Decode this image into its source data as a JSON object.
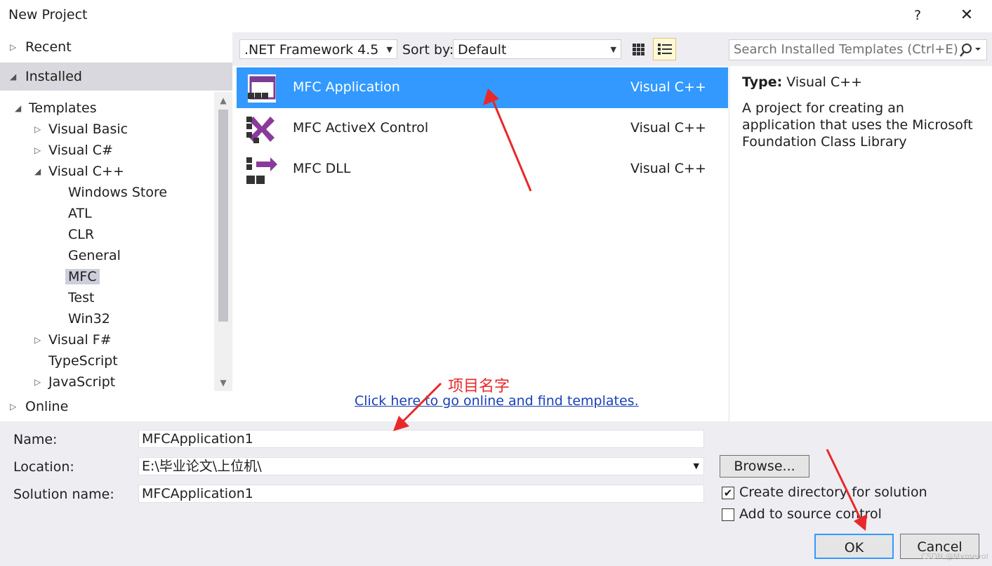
{
  "window": {
    "title": "New Project",
    "help_label": "?",
    "close_label": "✕"
  },
  "left_nav": {
    "recent": "Recent",
    "installed": "Installed",
    "online": "Online",
    "tree": [
      {
        "label": "Templates",
        "level": 0,
        "expanded": true
      },
      {
        "label": "Visual Basic",
        "level": 1,
        "expanded": false
      },
      {
        "label": "Visual C#",
        "level": 1,
        "expanded": false
      },
      {
        "label": "Visual C++",
        "level": 1,
        "expanded": true
      },
      {
        "label": "Windows Store",
        "level": 2
      },
      {
        "label": "ATL",
        "level": 2
      },
      {
        "label": "CLR",
        "level": 2
      },
      {
        "label": "General",
        "level": 2
      },
      {
        "label": "MFC",
        "level": 2,
        "selected": true
      },
      {
        "label": "Test",
        "level": 2
      },
      {
        "label": "Win32",
        "level": 2
      },
      {
        "label": "Visual F#",
        "level": 1,
        "expanded": false
      },
      {
        "label": "TypeScript",
        "level": 1
      },
      {
        "label": "JavaScript",
        "level": 1,
        "expanded": false
      }
    ]
  },
  "toolbar": {
    "framework": ".NET Framework 4.5",
    "sort_label": "Sort by:",
    "sort_value": "Default",
    "search_placeholder": "Search Installed Templates (Ctrl+E)"
  },
  "templates": [
    {
      "name": "MFC Application",
      "language": "Visual C++",
      "selected": true
    },
    {
      "name": "MFC ActiveX Control",
      "language": "Visual C++"
    },
    {
      "name": "MFC DLL",
      "language": "Visual C++"
    }
  ],
  "online_link": "Click here to go online and find templates.",
  "details": {
    "type_label": "Type:",
    "type_value": "Visual C++",
    "description": "A project for creating an application that uses the Microsoft Foundation Class Library"
  },
  "form": {
    "name_label": "Name:",
    "name_value": "MFCApplication1",
    "location_label": "Location:",
    "location_value": "E:\\毕业论文\\上位机\\",
    "solution_label": "Solution name:",
    "solution_value": "MFCApplication1",
    "browse_label": "Browse...",
    "create_dir_label": "Create directory for solution",
    "create_dir_checked": true,
    "add_source_label": "Add to source control",
    "add_source_checked": false,
    "ok_label": "OK",
    "cancel_label": "Cancel"
  },
  "annotation": {
    "text": "项目名字",
    "color": "#e8282a"
  },
  "watermark": "CSDN @Mxmevol",
  "colors": {
    "selection": "#3399ff",
    "panel": "#eeeef2",
    "link": "#1a3fb8"
  }
}
